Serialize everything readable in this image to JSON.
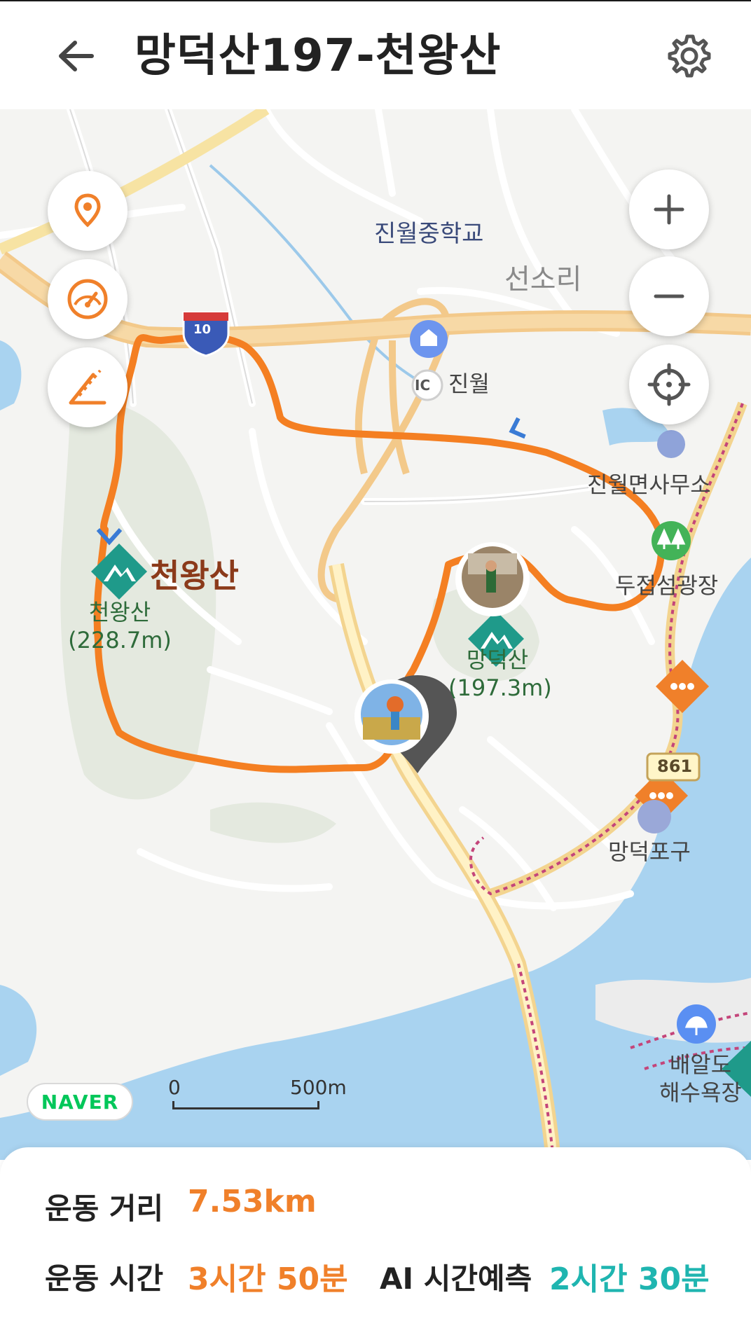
{
  "header": {
    "title": "망덕산197-천왕산",
    "back_icon": "arrow-left-icon",
    "settings_icon": "gear-icon"
  },
  "map": {
    "labels": {
      "school": "진월중학교",
      "village": "선소리",
      "ic": "진월",
      "ic_badge": "IC",
      "highway_shield": "10",
      "office": "진월면사무소",
      "plaza": "두접섬광장",
      "peak1_name": "천왕산",
      "peak1_small": "천왕산",
      "peak1_height": "(228.7m)",
      "peak2_name": "망덕산",
      "peak2_height": "(197.3m)",
      "road_number": "861",
      "port": "망덕포구",
      "beach_line1": "배알도",
      "beach_line2": "해수욕장"
    },
    "controls": {
      "location_icon": "map-pin-icon",
      "speed_icon": "speedometer-icon",
      "slope_icon": "slope-icon",
      "zoom_in_icon": "plus-icon",
      "zoom_out_icon": "minus-icon",
      "gps_icon": "crosshair-icon"
    },
    "attribution": "NAVER",
    "scale": {
      "zero": "0",
      "max": "500m"
    },
    "colors": {
      "track": "#f47f22",
      "road_major": "#f3c98a",
      "water": "#a9d3f0",
      "forest": "#e4e9df",
      "peak_marker": "#1f9a8a"
    }
  },
  "stats": {
    "distance_label": "운동 거리",
    "distance_value": "7.53km",
    "time_label": "운동 시간",
    "time_value": "3시간 50분",
    "ai_label": "AI 시간예측",
    "ai_value": "2시간 30분"
  }
}
